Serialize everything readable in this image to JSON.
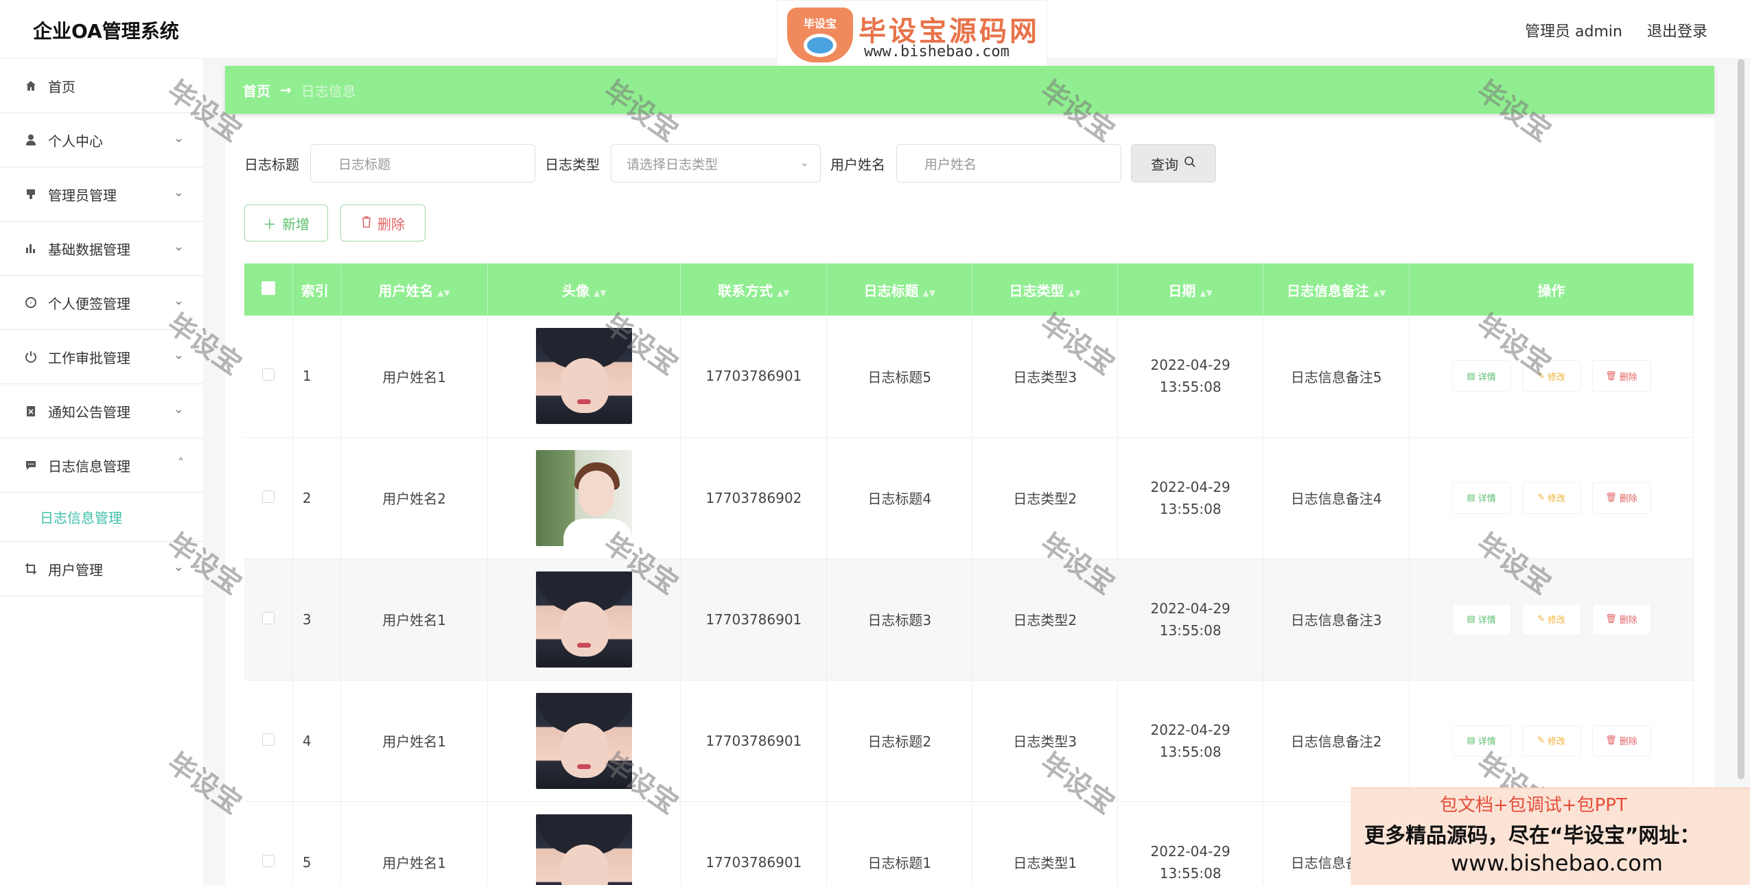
{
  "app": {
    "title": "企业OA管理系统"
  },
  "header": {
    "admin_label": "管理员 admin",
    "logout_label": "退出登录"
  },
  "banner": {
    "badge": "毕设宝",
    "brand": "毕设宝源码网",
    "url": "www.bishebao.com"
  },
  "sidebar": {
    "items": [
      {
        "label": "首页",
        "icon": "home-icon",
        "has_chevron": false
      },
      {
        "label": "个人中心",
        "icon": "user-icon",
        "has_chevron": true
      },
      {
        "label": "管理员管理",
        "icon": "admin-icon",
        "has_chevron": true
      },
      {
        "label": "基础数据管理",
        "icon": "bar-chart-icon",
        "has_chevron": true
      },
      {
        "label": "个人便签管理",
        "icon": "compass-icon",
        "has_chevron": true
      },
      {
        "label": "工作审批管理",
        "icon": "power-icon",
        "has_chevron": true
      },
      {
        "label": "通知公告管理",
        "icon": "clipboard-icon",
        "has_chevron": true
      },
      {
        "label": "日志信息管理",
        "icon": "message-icon",
        "has_chevron": true,
        "expanded": true
      },
      {
        "label": "用户管理",
        "icon": "crop-icon",
        "has_chevron": true
      }
    ],
    "subitem": "日志信息管理"
  },
  "breadcrumb": {
    "home": "首页",
    "separator": "→",
    "current": "日志信息"
  },
  "search": {
    "title_label": "日志标题",
    "title_placeholder": "日志标题",
    "type_label": "日志类型",
    "type_placeholder": "请选择日志类型",
    "user_label": "用户姓名",
    "user_placeholder": "用户姓名",
    "query_label": "查询"
  },
  "actions": {
    "add_label": "新增",
    "delete_label": "删除"
  },
  "table": {
    "headers": [
      "索引",
      "用户姓名",
      "头像",
      "联系方式",
      "日志标题",
      "日志类型",
      "日期",
      "日志信息备注",
      "操作"
    ],
    "op_labels": {
      "detail": "详情",
      "edit": "修改",
      "delete": "删除"
    },
    "rows": [
      {
        "index": "1",
        "user": "用户姓名1",
        "avatar": "a1",
        "phone": "17703786901",
        "title": "日志标题5",
        "type": "日志类型3",
        "date": "2022-04-29 13:55:08",
        "remark": "日志信息备注5"
      },
      {
        "index": "2",
        "user": "用户姓名2",
        "avatar": "a2",
        "phone": "17703786902",
        "title": "日志标题4",
        "type": "日志类型2",
        "date": "2022-04-29 13:55:08",
        "remark": "日志信息备注4"
      },
      {
        "index": "3",
        "user": "用户姓名1",
        "avatar": "a1",
        "phone": "17703786901",
        "title": "日志标题3",
        "type": "日志类型2",
        "date": "2022-04-29 13:55:08",
        "remark": "日志信息备注3"
      },
      {
        "index": "4",
        "user": "用户姓名1",
        "avatar": "a1",
        "phone": "17703786901",
        "title": "日志标题2",
        "type": "日志类型3",
        "date": "2022-04-29 13:55:08",
        "remark": "日志信息备注2"
      },
      {
        "index": "5",
        "user": "用户姓名1",
        "avatar": "a1",
        "phone": "17703786901",
        "title": "日志标题1",
        "type": "日志类型1",
        "date": "2022-04-29 13:55:08",
        "remark": "日志信息备注1"
      }
    ]
  },
  "watermark": {
    "text": "毕设宝"
  },
  "ad": {
    "line1": "包文档+包调试+包PPT",
    "line2": "更多精品源码，尽在“毕设宝”网址：",
    "line3": "www.bishebao.com"
  },
  "colors": {
    "accent": "#90ee90",
    "link": "#3fc0a8",
    "danger": "#e26464",
    "warning": "#f0b43a"
  }
}
